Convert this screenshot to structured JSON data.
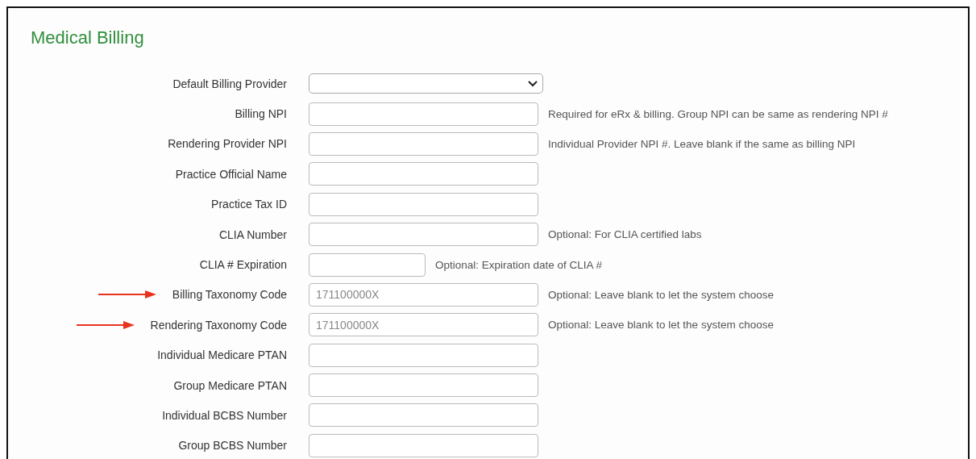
{
  "title": "Medical Billing",
  "fields": [
    {
      "label": "Default Billing Provider",
      "kind": "select",
      "arrow": false
    },
    {
      "label": "Billing NPI",
      "kind": "text",
      "arrow": false,
      "hint": "Required for eRx & billing. Group NPI can be same as rendering NPI #"
    },
    {
      "label": "Rendering Provider NPI",
      "kind": "text",
      "arrow": false,
      "hint": "Individual Provider NPI #. Leave blank if the same as billing NPI"
    },
    {
      "label": "Practice Official Name",
      "kind": "text",
      "arrow": false
    },
    {
      "label": "Practice Tax ID",
      "kind": "text",
      "arrow": false
    },
    {
      "label": "CLIA Number",
      "kind": "text",
      "arrow": false,
      "hint": "Optional: For CLIA certified labs"
    },
    {
      "label": "CLIA # Expiration",
      "kind": "short",
      "arrow": false,
      "hint": "Optional: Expiration date of CLIA #"
    },
    {
      "label": "Billing Taxonomy Code",
      "kind": "text",
      "arrow": true,
      "placeholder": "171100000X",
      "hint": "Optional: Leave blank to let the system choose"
    },
    {
      "label": "Rendering Taxonomy Code",
      "kind": "text",
      "arrow": true,
      "placeholder": "171100000X",
      "hint": "Optional: Leave blank to let the system choose"
    },
    {
      "label": "Individual Medicare PTAN",
      "kind": "text",
      "arrow": false
    },
    {
      "label": "Group Medicare PTAN",
      "kind": "text",
      "arrow": false
    },
    {
      "label": "Individual BCBS Number",
      "kind": "text",
      "arrow": false
    },
    {
      "label": "Group BCBS Number",
      "kind": "text",
      "arrow": false
    }
  ]
}
